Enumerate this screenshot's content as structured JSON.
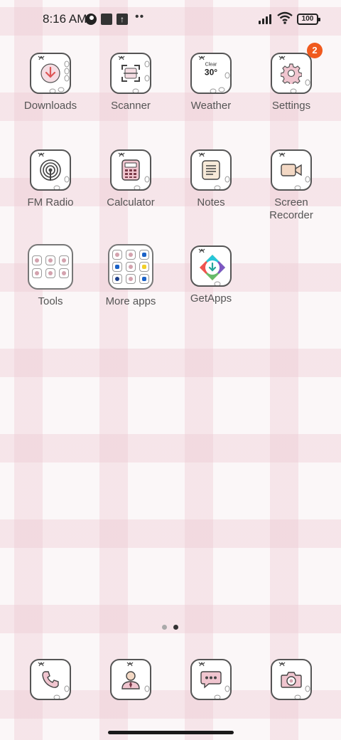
{
  "status_bar": {
    "time": "8:16 AM",
    "battery": "100",
    "icons": [
      "notification-circle-icon",
      "square-notification-icon",
      "upload-icon",
      "more-dots-icon",
      "signal-icon",
      "wifi-icon",
      "battery-icon"
    ],
    "more_dots": "••"
  },
  "apps": {
    "row1": [
      {
        "label": "Downloads",
        "icon": "download-arrow-icon"
      },
      {
        "label": "Scanner",
        "icon": "scan-frame-icon"
      },
      {
        "label": "Weather",
        "icon": "weather-icon",
        "condition": "Clear",
        "temp": "30°"
      },
      {
        "label": "Settings",
        "icon": "gear-icon",
        "badge": "2"
      }
    ],
    "row2": [
      {
        "label": "FM Radio",
        "icon": "radio-waves-icon"
      },
      {
        "label": "Calculator",
        "icon": "calculator-icon"
      },
      {
        "label": "Notes",
        "icon": "notepad-icon"
      },
      {
        "label": "Screen Recorder",
        "icon": "video-camera-icon"
      }
    ],
    "row3": [
      {
        "label": "Tools",
        "icon": "folder-icon"
      },
      {
        "label": "More apps",
        "icon": "folder-icon"
      },
      {
        "label": "GetApps",
        "icon": "getapps-icon"
      }
    ]
  },
  "page_indicator": {
    "count": 2,
    "active": 2
  },
  "dock": [
    {
      "icon": "phone-icon"
    },
    {
      "icon": "contacts-icon"
    },
    {
      "icon": "messages-icon"
    },
    {
      "icon": "camera-icon"
    }
  ],
  "colors": {
    "badge": "#f05a1e",
    "plaid_pink": "#ecc4ce",
    "icon_accent": "#d4a2ae"
  }
}
